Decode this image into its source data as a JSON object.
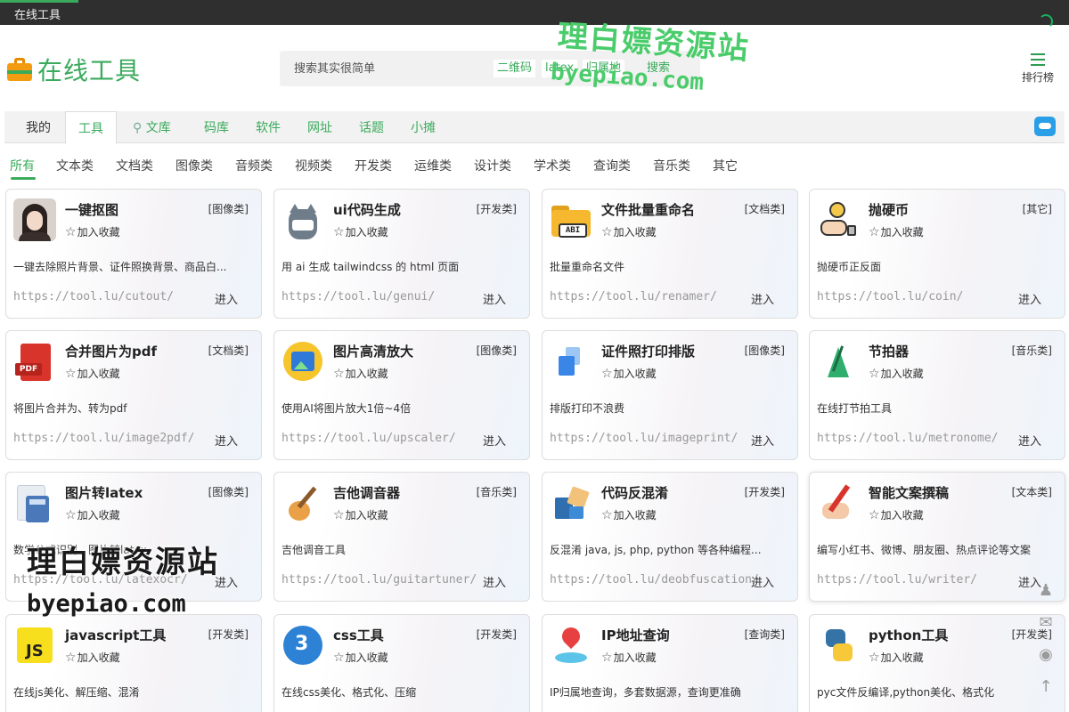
{
  "window": {
    "title": "在线工具"
  },
  "header": {
    "logo_text": "在线工具",
    "search": {
      "placeholder": "搜索其实很简单",
      "quick_tags": [
        "二维码",
        "latex",
        "归属地"
      ],
      "button": "搜索"
    },
    "rank_label": "排行榜"
  },
  "nav": {
    "tabs": [
      "我的",
      "工具",
      "文库",
      "码库",
      "软件",
      "网址",
      "话题",
      "小摊"
    ],
    "active": "工具"
  },
  "categories": {
    "items": [
      "所有",
      "文本类",
      "文档类",
      "图像类",
      "音频类",
      "视频类",
      "开发类",
      "运维类",
      "设计类",
      "学术类",
      "查询类",
      "音乐类",
      "其它"
    ],
    "active": "所有"
  },
  "fav_label": "加入收藏",
  "enter_label": "进入",
  "tools": [
    {
      "name": "一键抠图",
      "type": "[图像类]",
      "desc": "一键去除照片背景、证件照换背景、商品白...",
      "url": "https://tool.lu/cutout/",
      "icon": "person-photo-icon"
    },
    {
      "name": "ui代码生成",
      "type": "[开发类]",
      "desc": "用 ai 生成 tailwindcss 的 html 页面",
      "url": "https://tool.lu/genui/",
      "icon": "cat-mascot-icon"
    },
    {
      "name": "文件批量重命名",
      "type": "[文档类]",
      "desc": "批量重命名文件",
      "url": "https://tool.lu/renamer/",
      "icon": "folder-abi-icon"
    },
    {
      "name": "抛硬币",
      "type": "[其它]",
      "desc": "抛硬币正反面",
      "url": "https://tool.lu/coin/",
      "icon": "coin-flip-icon"
    },
    {
      "name": "合并图片为pdf",
      "type": "[文档类]",
      "desc": "将图片合并为、转为pdf",
      "url": "https://tool.lu/image2pdf/",
      "icon": "pdf-icon"
    },
    {
      "name": "图片高清放大",
      "type": "[图像类]",
      "desc": "使用AI将图片放大1倍~4倍",
      "url": "https://tool.lu/upscaler/",
      "icon": "image-upscale-icon"
    },
    {
      "name": "证件照打印排版",
      "type": "[图像类]",
      "desc": "排版打印不浪费",
      "url": "https://tool.lu/imageprint/",
      "icon": "photo-print-icon"
    },
    {
      "name": "节拍器",
      "type": "[音乐类]",
      "desc": "在线打节拍工具",
      "url": "https://tool.lu/metronome/",
      "icon": "metronome-icon"
    },
    {
      "name": "图片转latex",
      "type": "[图像类]",
      "desc": "数学公式识别、图片转latex",
      "url": "https://tool.lu/latexocr/",
      "icon": "calculator-icon"
    },
    {
      "name": "吉他调音器",
      "type": "[音乐类]",
      "desc": "吉他调音工具",
      "url": "https://tool.lu/guitartuner/",
      "icon": "guitar-icon"
    },
    {
      "name": "代码反混淆",
      "type": "[开发类]",
      "desc": "反混淆 java, js, php, python 等各种编程...",
      "url": "https://tool.lu/deobfuscation/",
      "icon": "puzzle-icon"
    },
    {
      "name": "智能文案撰稿",
      "type": "[文本类]",
      "desc": "编写小红书、微博、朋友圈、热点评论等文案",
      "url": "https://tool.lu/writer/",
      "icon": "pen-writing-icon"
    },
    {
      "name": "javascript工具",
      "type": "[开发类]",
      "desc": "在线js美化、解压缩、混淆",
      "url": "",
      "icon": "js-icon"
    },
    {
      "name": "css工具",
      "type": "[开发类]",
      "desc": "在线css美化、格式化、压缩",
      "url": "",
      "icon": "css3-icon"
    },
    {
      "name": "IP地址查询",
      "type": "[查询类]",
      "desc": "IP归属地查询，多套数据源，查询更准确",
      "url": "",
      "icon": "ip-location-icon"
    },
    {
      "name": "python工具",
      "type": "[开发类]",
      "desc": "pyc文件反编译,python美化、格式化",
      "url": "",
      "icon": "python-icon"
    }
  ],
  "watermark": {
    "cn": "理白嫖资源站",
    "en": "byepiao.com"
  },
  "colors": {
    "brand": "#3aaa5c",
    "topbar": "#2f2f2f",
    "chat": "#2a9fe8"
  }
}
